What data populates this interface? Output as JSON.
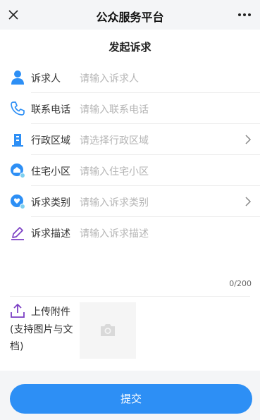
{
  "header": {
    "title": "公众服务平台",
    "close_icon": "close-icon",
    "more_icon": "more-icon"
  },
  "form": {
    "heading": "发起诉求",
    "fields": [
      {
        "label": "诉求人",
        "placeholder": "请输入诉求人",
        "icon": "person-icon",
        "chevron": false
      },
      {
        "label": "联系电话",
        "placeholder": "请输入联系电话",
        "icon": "phone-icon",
        "chevron": false
      },
      {
        "label": "行政区域",
        "placeholder": "请选择行政区域",
        "icon": "building-icon",
        "chevron": true
      },
      {
        "label": "住宅小区",
        "placeholder": "请输入住宅小区",
        "icon": "community-icon",
        "chevron": false
      },
      {
        "label": "诉求类别",
        "placeholder": "请输入诉求类别",
        "icon": "category-icon",
        "chevron": true
      },
      {
        "label": "诉求描述",
        "placeholder": "请输入诉求描述",
        "icon": "pen-icon",
        "chevron": false
      }
    ],
    "description_counter": "0/200",
    "attachment": {
      "label": "上传附件",
      "note": "(支持图片与文档)",
      "icon": "upload-icon",
      "box_icon": "camera-icon"
    }
  },
  "submit_label": "提交",
  "colors": {
    "primary": "#2d8ff5",
    "accent_purple": "#7b3fc4",
    "page_bg": "#f4f5f7",
    "placeholder": "#b5b5b5"
  }
}
